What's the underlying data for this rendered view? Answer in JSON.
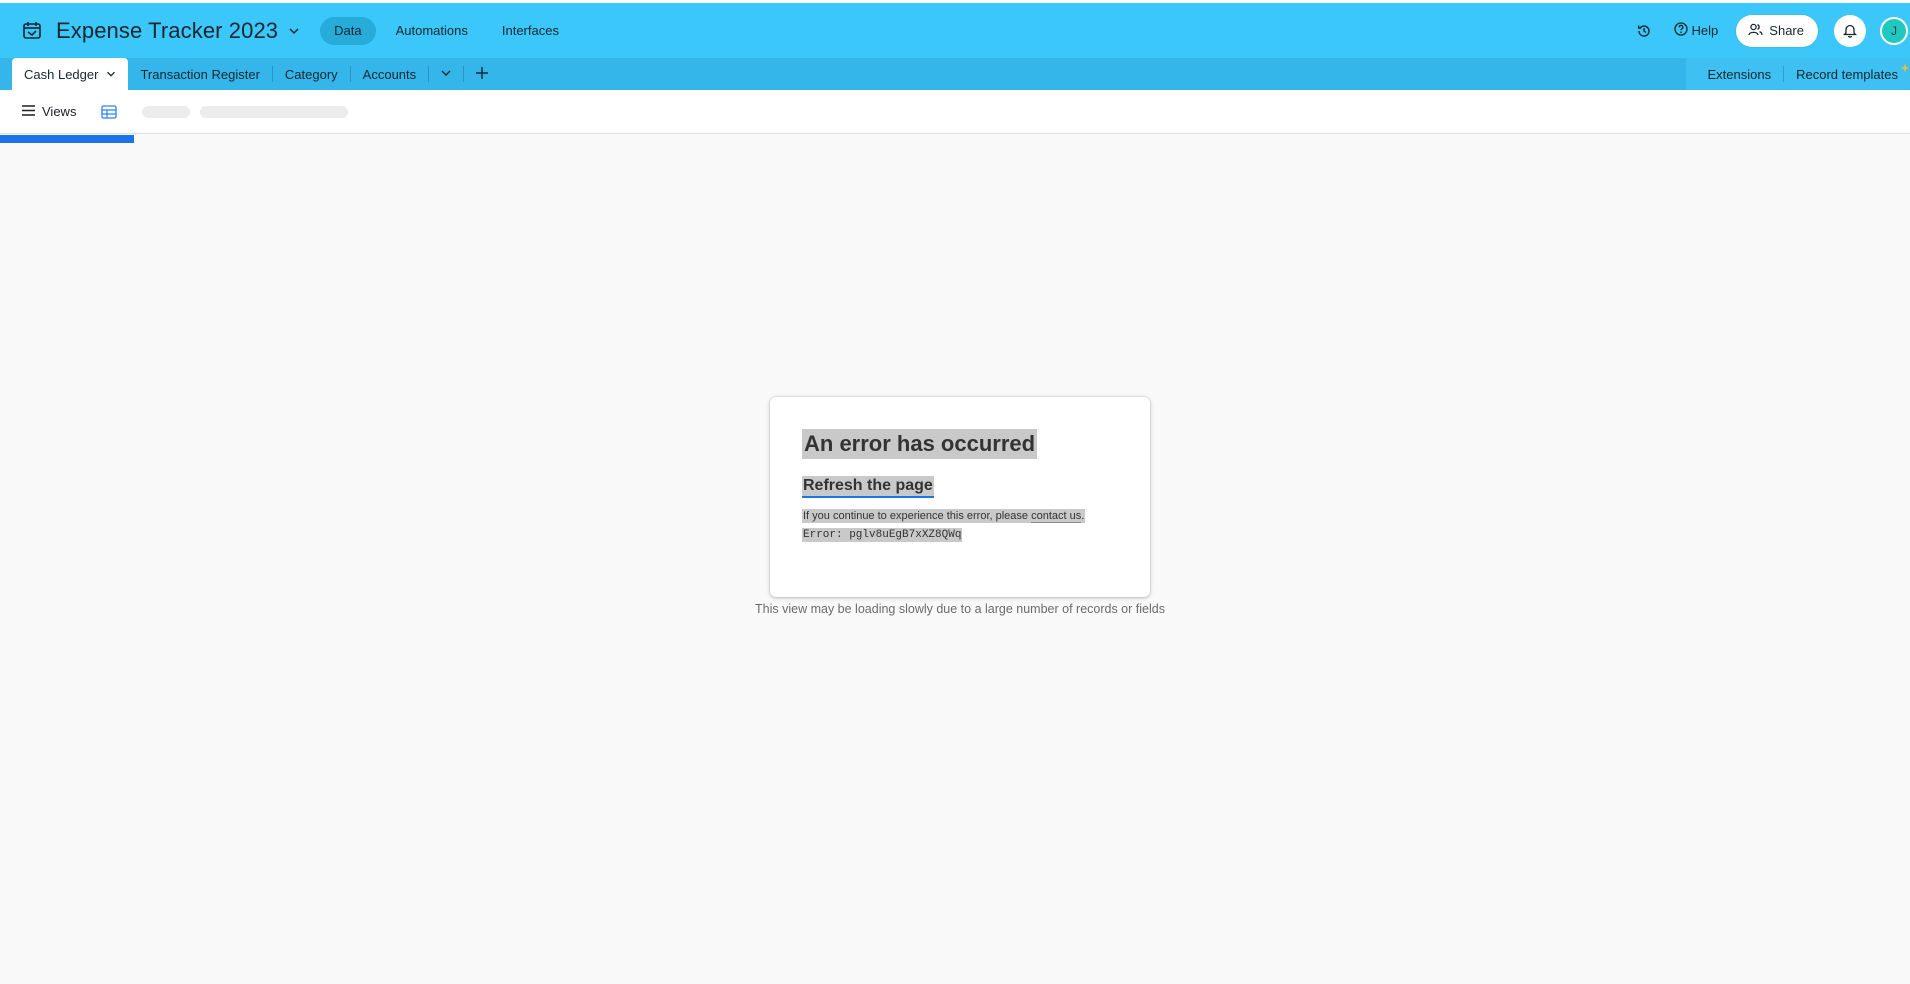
{
  "app": {
    "base_title": "Expense Tracker 2023",
    "nav": [
      {
        "label": "Data",
        "active": true
      },
      {
        "label": "Automations",
        "active": false
      },
      {
        "label": "Interfaces",
        "active": false
      }
    ],
    "help_label": "Help",
    "share_label": "Share",
    "avatar_initial": "J",
    "icons": {
      "logo": "base-logo-icon",
      "history": "history-icon",
      "help": "help-circle-icon",
      "share": "users-icon",
      "bell": "bell-icon"
    },
    "colors": {
      "topbar": "#3cc7fa",
      "tabsbar": "#34b6ea",
      "active_nav": "#27abd9",
      "avatar": "#20c9c0",
      "progress": "#1a73e8"
    }
  },
  "tabs": {
    "items": [
      {
        "label": "Cash Ledger",
        "active": true
      },
      {
        "label": "Transaction Register",
        "active": false
      },
      {
        "label": "Category",
        "active": false
      },
      {
        "label": "Accounts",
        "active": false
      }
    ],
    "right_links": [
      "Extensions",
      "Record templates"
    ]
  },
  "viewbar": {
    "views_label": "Views"
  },
  "error": {
    "title": "An error has occurred",
    "refresh_label": "Refresh the page",
    "message_prefix": "If you continue to experience this error, please ",
    "contact_label": "contact us",
    "message_suffix": ".",
    "code": "Error: pglv8uEgB7xXZ8QWq"
  },
  "loading_note": "This view may be loading slowly due to a large number of records or fields"
}
